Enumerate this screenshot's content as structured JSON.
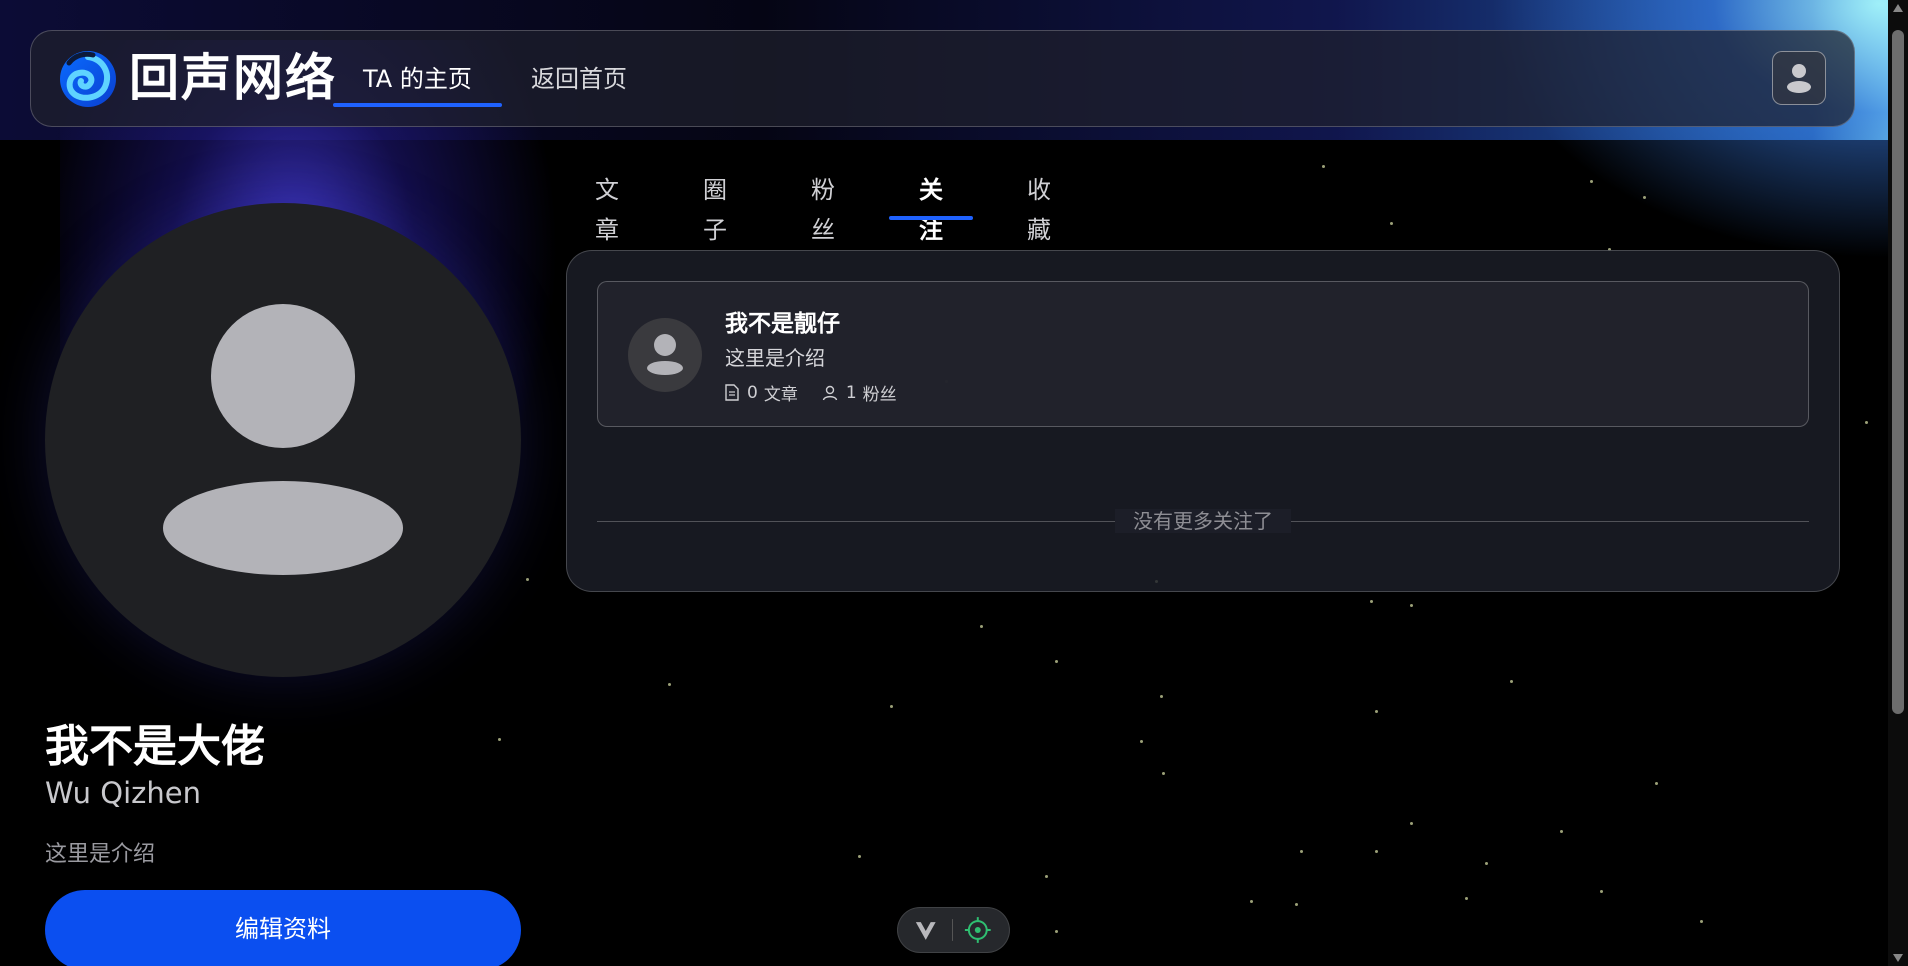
{
  "header": {
    "logo_text": "回声网络",
    "nav": [
      {
        "label": "TA 的主页",
        "active": true
      },
      {
        "label": "返回首页",
        "active": false
      }
    ],
    "user_icon": "user-icon"
  },
  "profile": {
    "name": "我不是大佬",
    "subname": "Wu Qizhen",
    "intro": "这里是介绍",
    "edit_label": "编辑资料"
  },
  "tabs": [
    {
      "label": "文章",
      "active": false
    },
    {
      "label": "圈子",
      "active": false
    },
    {
      "label": "粉丝",
      "active": false
    },
    {
      "label": "关注",
      "active": true
    },
    {
      "label": "收藏",
      "active": false
    }
  ],
  "following": [
    {
      "name": "我不是靓仔",
      "intro": "这里是介绍",
      "articles_count": "0",
      "articles_label": "文章",
      "fans_count": "1",
      "fans_label": "粉丝"
    }
  ],
  "list_end_text": "没有更多关注了",
  "colors": {
    "accent": "#1f62ff",
    "button": "#0b4ff0",
    "dev_green": "#2fbf71"
  }
}
